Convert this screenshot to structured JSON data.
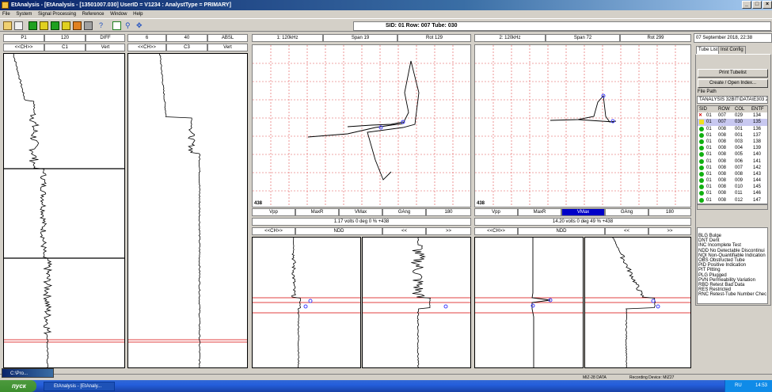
{
  "window": {
    "title": "EtAnalysis - [EtAnalysis - [13501007.030]     UserID = V1234 : AnalystType = PRIMARY]"
  },
  "menu": [
    "File",
    "System",
    "Signal Processing",
    "Reference",
    "Window",
    "Help"
  ],
  "tube_bar": {
    "text": "SID: 01   Row: 007   Tube: 030"
  },
  "strip1": {
    "h1": [
      "P1",
      "120",
      "DIFF"
    ],
    "h2": [
      "<<CH>>",
      "C1",
      "Vert"
    ]
  },
  "strip2": {
    "h1": [
      "6",
      "40",
      "ABSL"
    ],
    "h2": [
      "<<CH>>",
      "C3",
      "Vert"
    ]
  },
  "lissa1": {
    "header": [
      "1: 120kHz",
      "Span 19",
      "Rot 129"
    ],
    "stamp": "438",
    "measure_tabs": [
      "Vpp",
      "MaxR",
      "VMax",
      "GAng",
      "180"
    ],
    "readout": "1.17 volts   0 deg   0 % +438",
    "nav": [
      "<<CH>>",
      "NDD",
      "<<",
      ">>"
    ]
  },
  "lissa2": {
    "header": [
      "2: 120kHz",
      "Span 72",
      "Rot 299"
    ],
    "stamp": "438",
    "measure_tabs": [
      "Vpp",
      "MaxR",
      "VMax",
      "GAng",
      "180"
    ],
    "selected_tab": "VMax",
    "readout": "14.20 volts   0 deg   49 % +438",
    "nav": [
      "<<CH>>",
      "NDD",
      "<<",
      ">>"
    ]
  },
  "right": {
    "date": "07 September 2018, 22:38",
    "tabs": [
      "Tube List",
      "Inst Config"
    ],
    "print_button": "Print Tubelist",
    "index_button": "Create / Open Index...",
    "file_path_label": "File Path",
    "file_path": "TANALYSIS 32BIT\\DATA\\E303 2",
    "columns": [
      "SID",
      "ROW",
      "COL",
      "ENTF"
    ],
    "rows": [
      {
        "status": "x",
        "sid": "01",
        "row": "007",
        "col": "029",
        "entry": "134"
      },
      {
        "status": "yellow",
        "sid": "01",
        "row": "007",
        "col": "030",
        "entry": "135"
      },
      {
        "status": "green",
        "sid": "01",
        "row": "008",
        "col": "001",
        "entry": "136"
      },
      {
        "status": "green",
        "sid": "01",
        "row": "008",
        "col": "001",
        "entry": "137"
      },
      {
        "status": "green",
        "sid": "01",
        "row": "008",
        "col": "003",
        "entry": "138"
      },
      {
        "status": "green",
        "sid": "01",
        "row": "008",
        "col": "004",
        "entry": "139"
      },
      {
        "status": "green",
        "sid": "01",
        "row": "008",
        "col": "005",
        "entry": "140"
      },
      {
        "status": "green",
        "sid": "01",
        "row": "008",
        "col": "006",
        "entry": "141"
      },
      {
        "status": "green",
        "sid": "01",
        "row": "008",
        "col": "007",
        "entry": "142"
      },
      {
        "status": "green",
        "sid": "01",
        "row": "008",
        "col": "008",
        "entry": "143"
      },
      {
        "status": "green",
        "sid": "01",
        "row": "008",
        "col": "009",
        "entry": "144"
      },
      {
        "status": "green",
        "sid": "01",
        "row": "008",
        "col": "010",
        "entry": "145"
      },
      {
        "status": "green",
        "sid": "01",
        "row": "008",
        "col": "011",
        "entry": "146"
      },
      {
        "status": "green",
        "sid": "01",
        "row": "008",
        "col": "012",
        "entry": "147"
      }
    ],
    "codes": [
      "BLG  Bulge",
      "DNT  Dent",
      "INC  Incomplete Test",
      "NDD  No Detectable Discontinui",
      "NQI  Non-Quantifiable Indication",
      "OBS  Obstructed Tube",
      "PID  Positive Indication",
      "PIT  Pitting",
      "PLG  Plugged",
      "PVN  Permeability Variation",
      "RBD  Retest Bad Data",
      "RES  Restricted",
      "RNC  Retest-Tube Number Chec"
    ]
  },
  "status": {
    "left": "MIZ-28 DATA",
    "right": "Recording Device: MIZ27"
  },
  "taskbar": {
    "start": "пуск",
    "item": "EtAnalysis - [EtAnaly...",
    "lang": "RU",
    "time": "14:53",
    "minimized": "C:\\Pro..."
  },
  "colors": {
    "grid": "#e05050",
    "selected_tab": "#0000c8",
    "title_bar": "#0a246a",
    "marker": "#4040ff"
  }
}
